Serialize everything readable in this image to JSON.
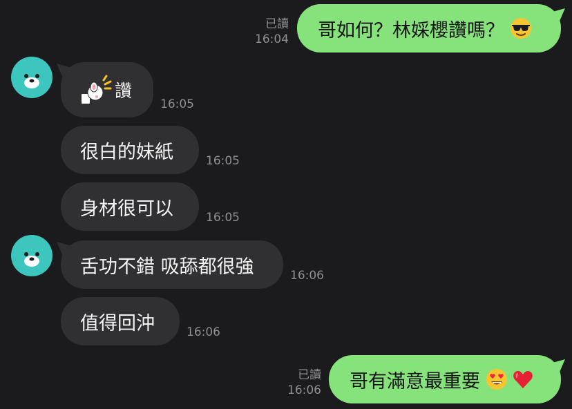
{
  "chat": {
    "messages": [
      {
        "direction": "outgoing",
        "read_label": "已讀",
        "time": "16:04",
        "text": "哥如何？林婇櫻讚嗎？",
        "emoji": [
          "sunglasses-face"
        ]
      },
      {
        "direction": "incoming",
        "time": "16:05",
        "text": "讚",
        "sticker": "thumbs-up-sticker"
      },
      {
        "direction": "incoming",
        "time": "16:05",
        "text": "很白的妹紙"
      },
      {
        "direction": "incoming",
        "time": "16:05",
        "text": "身材很可以"
      },
      {
        "direction": "incoming",
        "time": "16:06",
        "text": "舌功不錯 吸舔都很強"
      },
      {
        "direction": "incoming",
        "time": "16:06",
        "text": "值得回沖"
      },
      {
        "direction": "outgoing",
        "read_label": "已讀",
        "time": "16:06",
        "text": "哥有滿意最重要",
        "emoji": [
          "heart-eyes-face",
          "red-heart"
        ]
      }
    ]
  },
  "colors": {
    "background": "#1b1b1d",
    "incoming_bubble": "#303033",
    "outgoing_bubble": "#86e27a",
    "avatar": "#3cc6bd",
    "meta_text": "#8f8f93"
  }
}
